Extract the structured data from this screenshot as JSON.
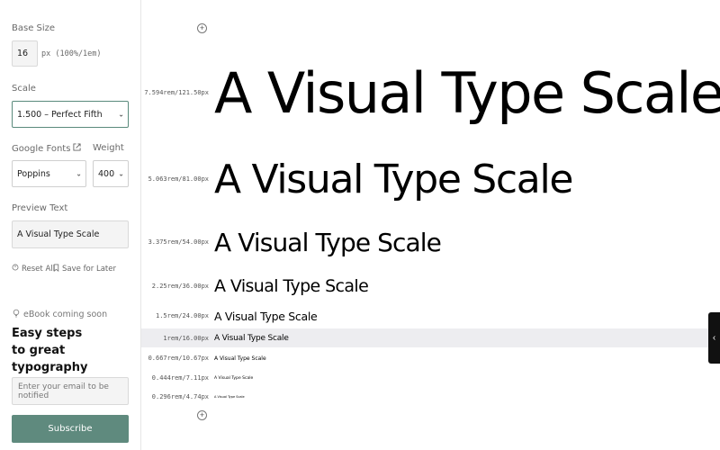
{
  "sidebar": {
    "base_size_label": "Base Size",
    "base_size_value": "16",
    "base_size_unit": "px (100%/1em)",
    "scale_label": "Scale",
    "scale_value": "1.500 – Perfect Fifth",
    "fonts_label": "Google Fonts",
    "weight_label": "Weight",
    "font_value": "Poppins",
    "weight_value": "400",
    "preview_label": "Preview Text",
    "preview_value": "A Visual Type Scale",
    "reset_label": "Reset All",
    "save_label": "Save for Later",
    "ebook_tag": "eBook coming soon",
    "ebook_title_1": "Easy steps",
    "ebook_title_2": "to great typography",
    "email_placeholder": "Enter your email to be notified",
    "subscribe_label": "Subscribe"
  },
  "scale": [
    {
      "size": "7.594rem/121.50px",
      "text": "A Visual Type Scale"
    },
    {
      "size": "5.063rem/81.00px",
      "text": "A Visual Type Scale"
    },
    {
      "size": "3.375rem/54.00px",
      "text": "A Visual Type Scale"
    },
    {
      "size": "2.25rem/36.00px",
      "text": "A Visual Type Scale"
    },
    {
      "size": "1.5rem/24.00px",
      "text": "A Visual Type Scale"
    },
    {
      "size": "1rem/16.00px",
      "text": "A Visual Type Scale",
      "highlight": true
    },
    {
      "size": "0.667rem/10.67px",
      "text": "A Visual Type Scale"
    },
    {
      "size": "0.444rem/7.11px",
      "text": "A Visual Type Scale"
    },
    {
      "size": "0.296rem/4.74px",
      "text": "A Visual Type Scale"
    }
  ],
  "colors": {
    "accent": "#5f8a7e",
    "highlight_row": "#ededf0"
  },
  "icons": {
    "add_top": "plus-circle-icon",
    "add_bottom": "plus-circle-icon",
    "external": "external-link-icon",
    "reset": "reset-icon",
    "save": "bookmark-icon",
    "bulb": "lightbulb-icon",
    "collapse": "chevron-left-icon"
  }
}
